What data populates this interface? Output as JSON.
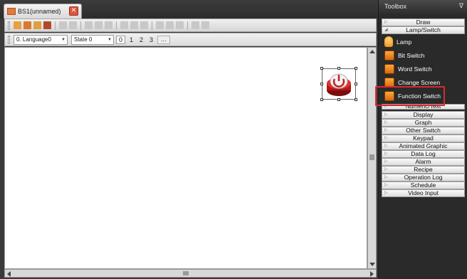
{
  "document_tab": {
    "label": "BS1(unnamed)",
    "close_glyph": "✕"
  },
  "toolbar2": {
    "language_select": "0. Language0",
    "state_select": "State 0",
    "state_numbers": [
      "0",
      "1",
      "2",
      "3"
    ],
    "more_button": "..."
  },
  "toolbox": {
    "title": "Toolbox",
    "pin_glyph": "ᐁ",
    "categories_top": [
      {
        "label": "Draw",
        "expanded": false
      },
      {
        "label": "Lamp/Switch",
        "expanded": true
      }
    ],
    "items": [
      {
        "label": "Lamp",
        "icon": "lamp-icon"
      },
      {
        "label": "Bit Switch",
        "icon": "bit-switch-icon"
      },
      {
        "label": "Word Switch",
        "icon": "word-switch-icon"
      },
      {
        "label": "Change Screen",
        "icon": "change-screen-icon"
      },
      {
        "label": "Function Switch",
        "icon": "function-switch-icon"
      }
    ],
    "categories_bottom": [
      {
        "label": "Numeric/Text"
      },
      {
        "label": "Display"
      },
      {
        "label": "Graph"
      },
      {
        "label": "Other Switch"
      },
      {
        "label": "Keypad"
      },
      {
        "label": "Animated Graphic"
      },
      {
        "label": "Data Log"
      },
      {
        "label": "Alarm"
      },
      {
        "label": "Recipe"
      },
      {
        "label": "Operation Log"
      },
      {
        "label": "Schedule"
      },
      {
        "label": "Video Input"
      }
    ]
  },
  "colors": {
    "highlight": "#d8292e",
    "switch_red": "#c81e1e",
    "icon_orange": "#f08a18"
  }
}
